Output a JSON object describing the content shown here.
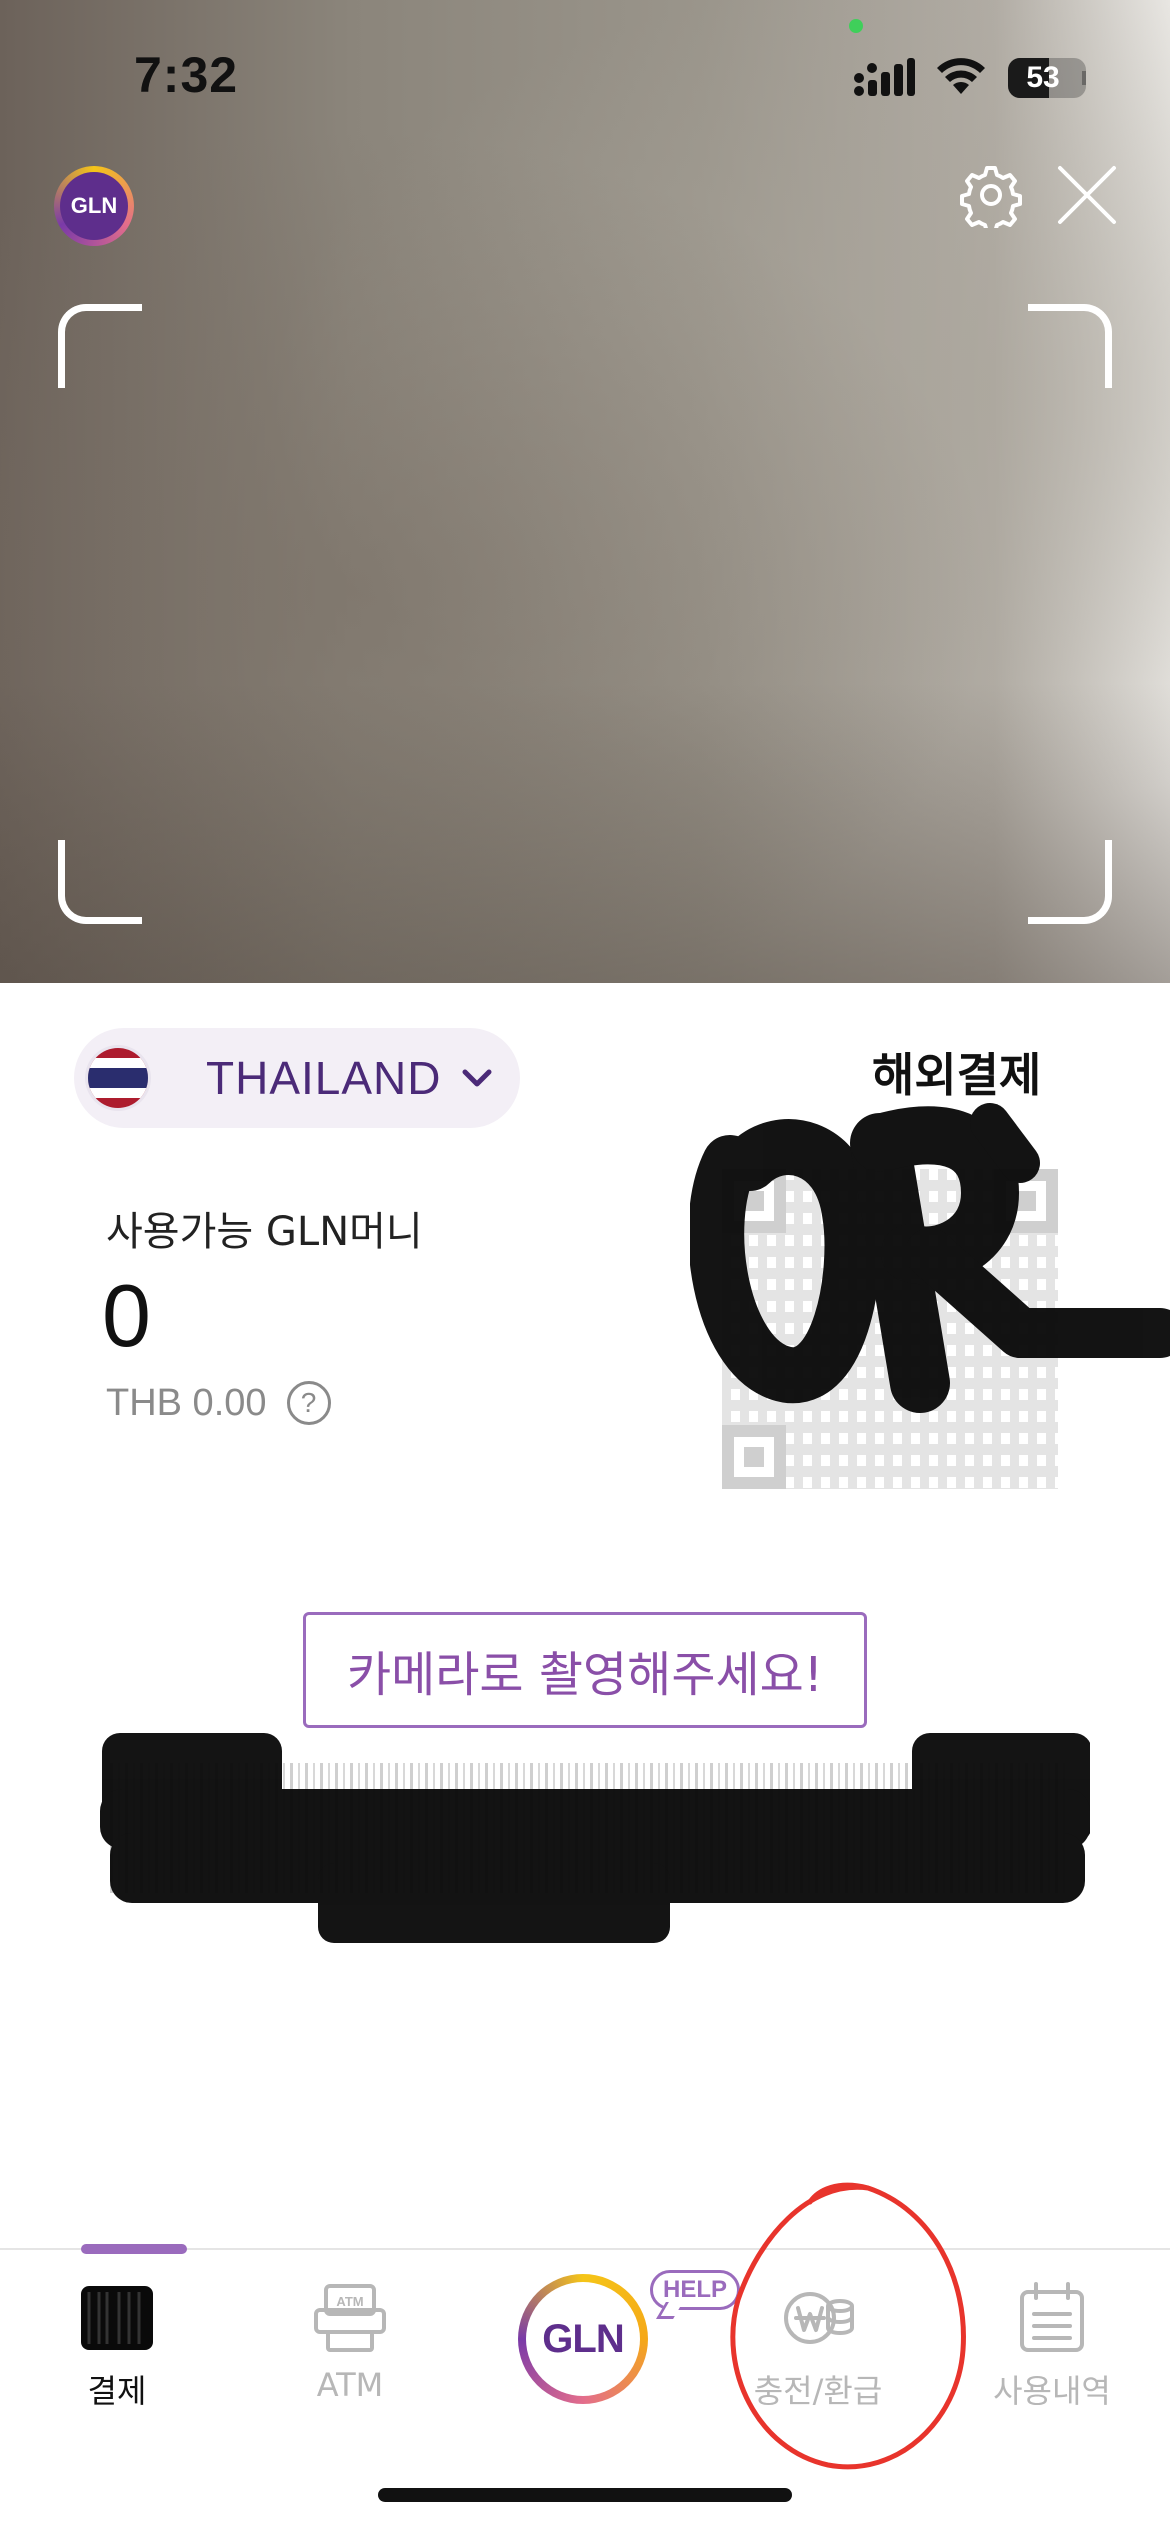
{
  "status_bar": {
    "time": "7:32",
    "battery": "53"
  },
  "camera": {
    "brand_badge": "GLN"
  },
  "wallet": {
    "country": "THAILAND",
    "mode_title": "해외결제",
    "balance_label": "사용가능 GLN머니",
    "balance_value": "0",
    "balance_sub": "THB 0.00",
    "help_mark": "?",
    "barcode_hint": "카메라로 촬영해주세요!"
  },
  "tabbar": {
    "items": [
      {
        "label": "결제",
        "icon": "barcode-icon",
        "active": true
      },
      {
        "label": "ATM",
        "icon": "atm-icon",
        "active": false
      },
      {
        "label": "GLN",
        "icon": "gln-logo-icon",
        "active": false
      },
      {
        "label": "충전/환급",
        "icon": "charge-refund-icon",
        "active": false
      },
      {
        "label": "사용내역",
        "icon": "history-icon",
        "active": false
      }
    ],
    "help_badge": "HELP"
  },
  "colors": {
    "brand_purple": "#5e2e8c",
    "accent_purple": "#9a6bbd",
    "annotation_red": "#e8342c"
  }
}
